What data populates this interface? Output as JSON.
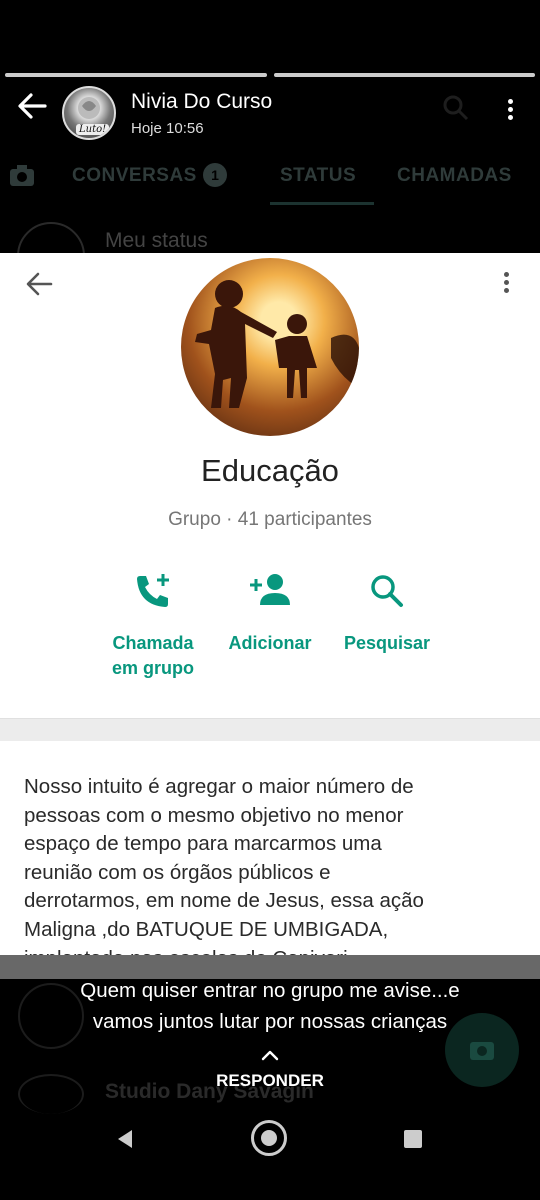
{
  "status_header": {
    "contact_name": "Nivia Do Curso",
    "time": "Hoje 10:56",
    "avatar_tag": "Luto!",
    "progress": [
      1.0,
      1.0
    ]
  },
  "background_app": {
    "tabs": [
      "CONVERSAS",
      "STATUS",
      "CHAMADAS"
    ],
    "unread_badge": "1",
    "my_status": "Meu status",
    "contact_partial": "Studio Dany Savagin"
  },
  "card": {
    "group_name": "Educação",
    "subtitle": "Grupo · 41 participantes",
    "actions": [
      {
        "icon": "call-add-icon",
        "label_line1": "Chamada",
        "label_line2": "em grupo"
      },
      {
        "icon": "person-add-icon",
        "label_line1": "Adicionar",
        "label_line2": ""
      },
      {
        "icon": "search-icon",
        "label_line1": "Pesquisar",
        "label_line2": ""
      }
    ],
    "description_lines": [
      "Nosso intuito é agregar o maior número de",
      "pessoas com o mesmo objetivo no menor",
      "espaço de tempo para marcarmos uma",
      "reunião com os órgãos públicos e",
      "derrotarmos, em nome de Jesus, essa ação",
      "Maligna ,do BATUQUE DE UMBIGADA,",
      "implantada nas escolas de Capivari."
    ],
    "accent_color": "#08977e"
  },
  "caption": {
    "line1": "Quem quiser entrar no grupo me avise...e",
    "line2": "vamos juntos lutar por nossas crianças"
  },
  "reply": {
    "label": "RESPONDER"
  }
}
